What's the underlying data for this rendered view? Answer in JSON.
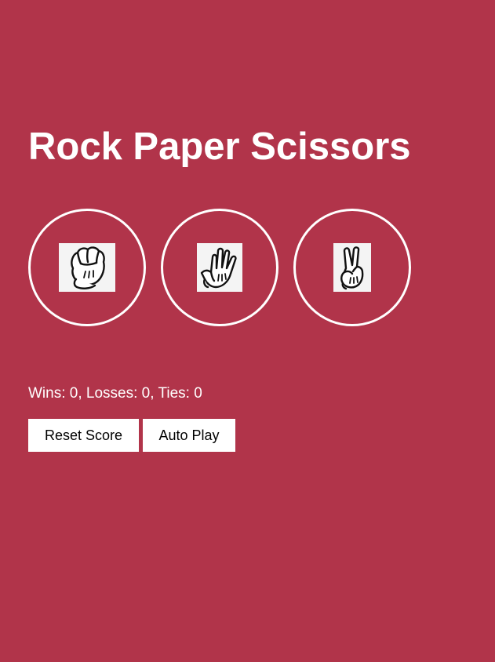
{
  "app": {
    "title": "Rock Paper Scissors",
    "background_color": "#b1344a"
  },
  "moves": [
    {
      "id": "rock",
      "icon": "rock-hand-icon"
    },
    {
      "id": "paper",
      "icon": "paper-hand-icon"
    },
    {
      "id": "scissors",
      "icon": "scissors-hand-icon"
    }
  ],
  "score": {
    "text": "Wins: 0, Losses: 0, Ties: 0",
    "wins": 0,
    "losses": 0,
    "ties": 0
  },
  "controls": {
    "reset_label": "Reset Score",
    "auto_play_label": "Auto Play"
  }
}
